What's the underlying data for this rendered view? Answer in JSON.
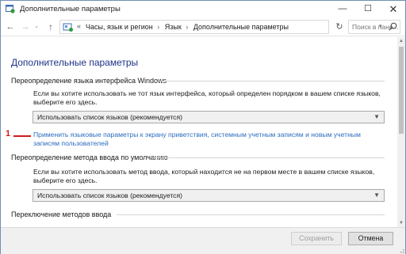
{
  "window": {
    "title": "Дополнительные параметры",
    "controls": {
      "minimize": "—",
      "maximize": "☐",
      "close": "✕"
    }
  },
  "address_bar": {
    "breadcrumbs": [
      "Часы, язык и регион",
      "Язык",
      "Дополнительные параметры"
    ],
    "first_sep": "«",
    "sep": "›",
    "search_placeholder": "Поиск в пане..."
  },
  "nav": {
    "back": "←",
    "forward": "→",
    "recent": "⌄",
    "up": "↑",
    "refresh": "↻",
    "dropdown": "▾"
  },
  "content": {
    "page_title": "Дополнительные параметры",
    "sections": [
      {
        "title": "Переопределение языка интерфейса Windows",
        "description": "Если вы хотите использовать не тот язык интерфейса, который определен порядком в вашем списке языков, выберите его здесь.",
        "select_value": "Использовать список языков (рекомендуется)",
        "link": "Применить языковые параметры к экрану приветствия, системным учетным записям и новым учетным записям пользователей"
      },
      {
        "title": "Переопределение метода ввода по умолчанию",
        "description": "Если вы хотите использовать метод ввода, который находится не на первом месте в вашем списке языков, выберите его здесь.",
        "select_value": "Использовать список языков (рекомендуется)"
      },
      {
        "title": "Переключение методов ввода"
      }
    ],
    "annotation_number": "1"
  },
  "footer": {
    "save": "Сохранить",
    "cancel": "Отмена"
  },
  "colors": {
    "title_blue": "#1e3287",
    "link_blue": "#2a6cc0",
    "annotation_red": "#d01a1a"
  }
}
